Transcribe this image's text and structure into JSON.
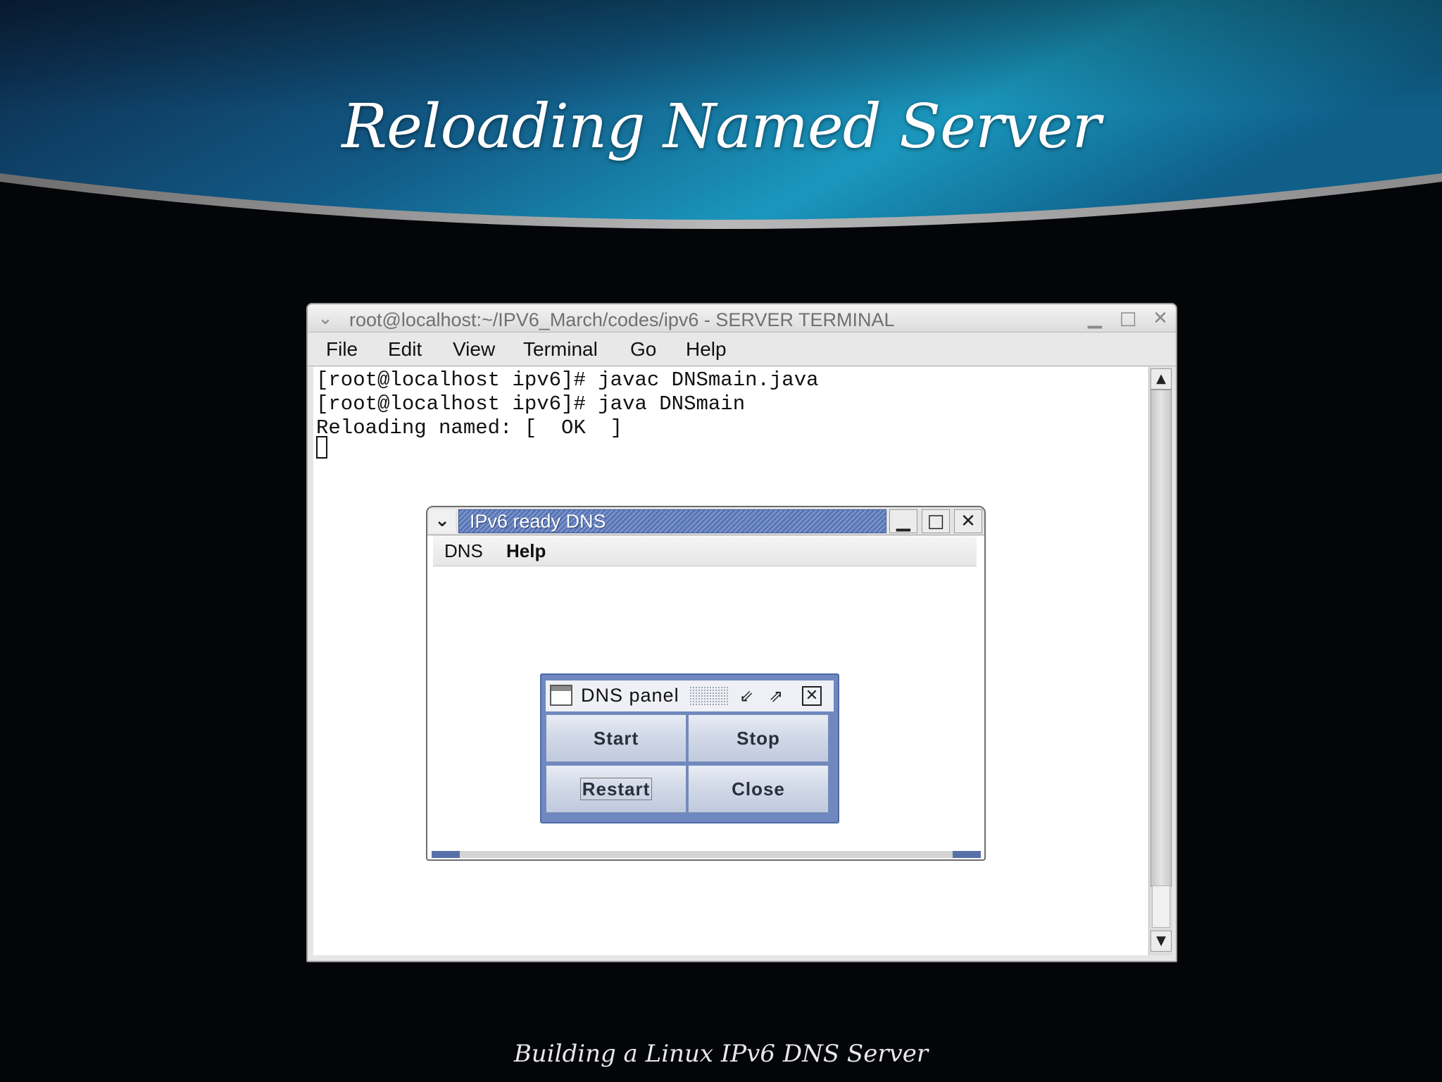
{
  "slide": {
    "title": "Reloading Named Server",
    "footer": "Building a Linux IPv6 DNS Server"
  },
  "terminal": {
    "window_title": "root@localhost:~/IPV6_March/codes/ipv6 - SERVER TERMINAL",
    "menu": [
      "File",
      "Edit",
      "View",
      "Terminal",
      "Go",
      "Help"
    ],
    "lines": [
      "[root@localhost ipv6]# javac DNSmain.java",
      "[root@localhost ipv6]# java DNSmain",
      "Reloading named: [  OK  ]"
    ],
    "icons": {
      "window_menu": "chevron-down-icon",
      "minimize": "minimize-icon",
      "maximize": "maximize-icon",
      "close": "close-icon",
      "scroll_up": "arrow-up-icon",
      "scroll_down": "arrow-down-icon"
    }
  },
  "dns_window": {
    "title": "IPv6 ready DNS",
    "menu": [
      "DNS",
      "Help"
    ]
  },
  "dns_panel": {
    "title": "DNS panel",
    "buttons": {
      "start": "Start",
      "stop": "Stop",
      "restart": "Restart",
      "close": "Close"
    }
  },
  "colors": {
    "header_light": "#1a9cc0",
    "header_dark": "#0d2a4e",
    "panel_frame": "#6f88bf",
    "title_fill": "#5875b4"
  }
}
